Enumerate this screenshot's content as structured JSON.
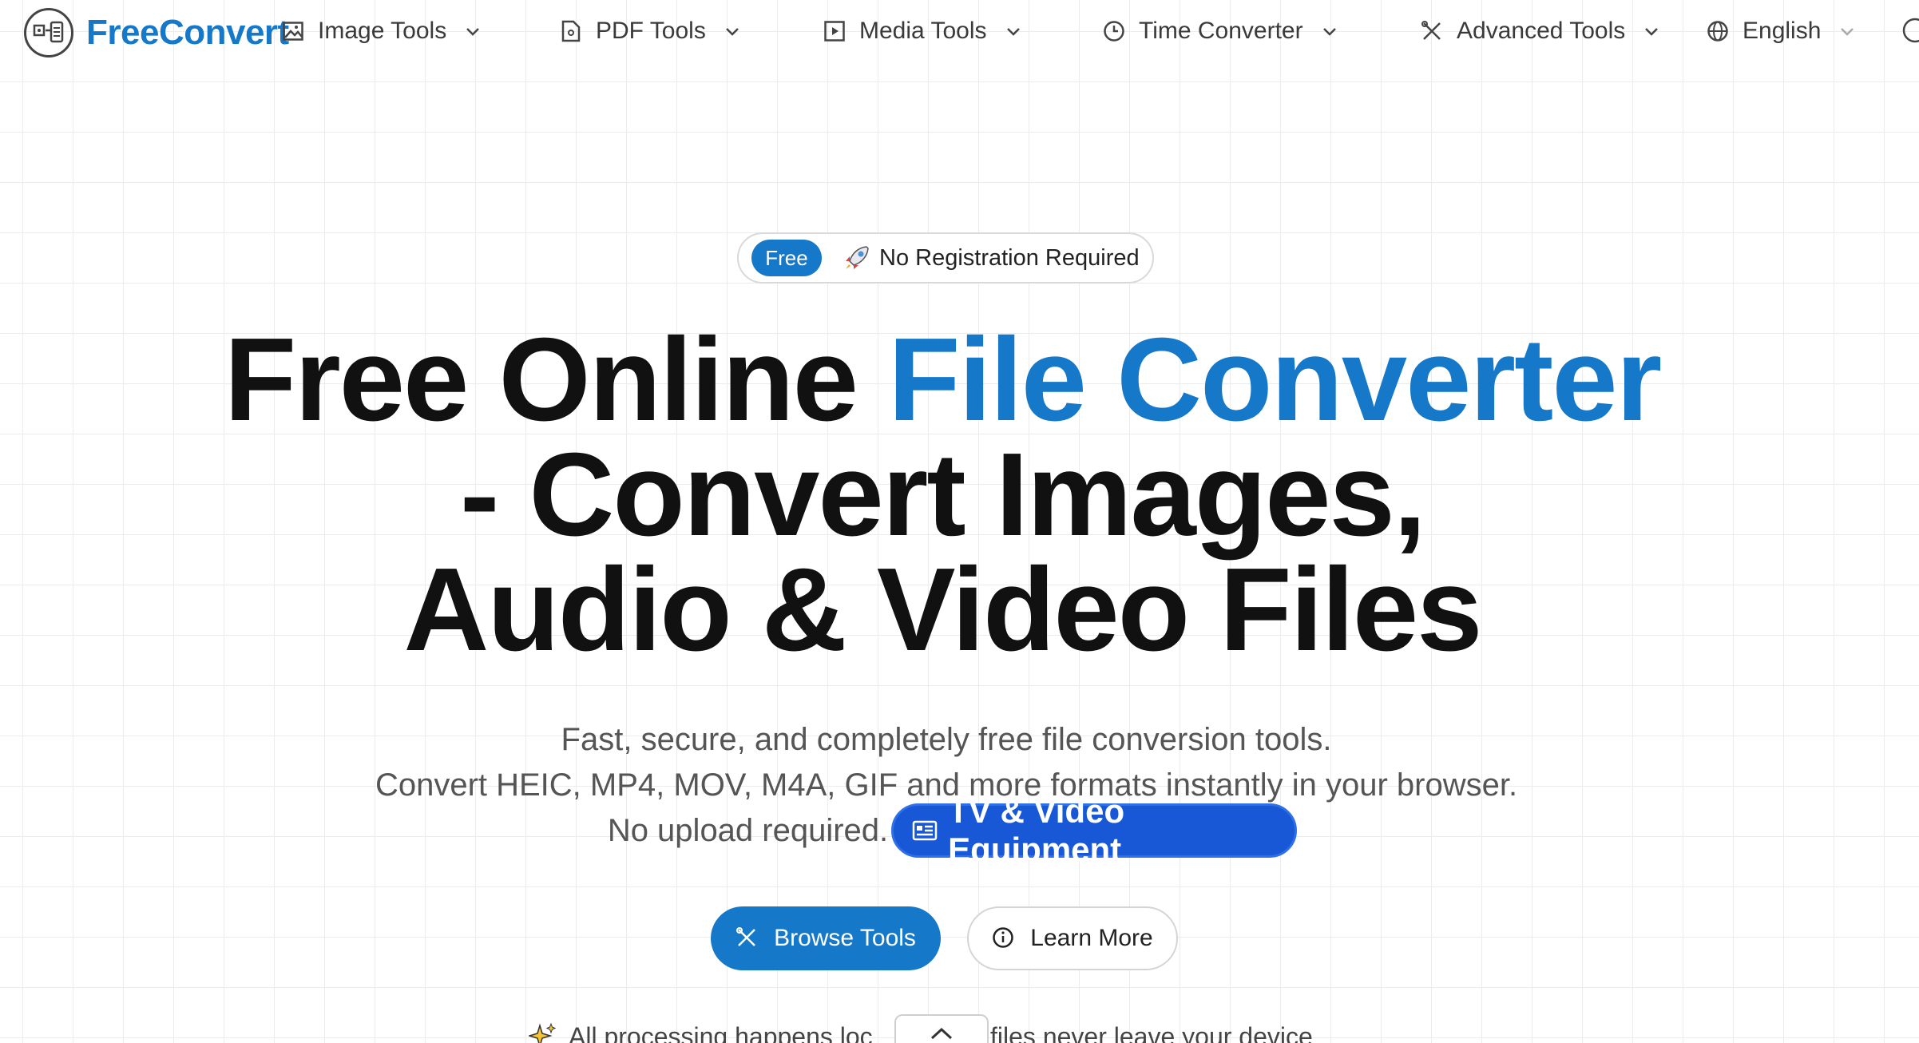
{
  "brand": {
    "name": "FreeConvert"
  },
  "nav": {
    "items": [
      {
        "label": "Image Tools",
        "icon": "image-icon"
      },
      {
        "label": "PDF Tools",
        "icon": "document-icon"
      },
      {
        "label": "Media Tools",
        "icon": "play-icon"
      },
      {
        "label": "Time Converter",
        "icon": "clock-icon"
      },
      {
        "label": "Advanced Tools",
        "icon": "tools-icon"
      },
      {
        "label": "English",
        "icon": "globe-icon"
      }
    ]
  },
  "badge": {
    "pill": "Free",
    "text": "No Registration Required",
    "icon": "rocket-icon"
  },
  "headline": {
    "part1": "Free Online ",
    "accent": "File Converter",
    "line2": "- Convert Images,",
    "line3": "Audio & Video Files"
  },
  "subtext": {
    "line1": "Fast, secure, and completely free file conversion tools.",
    "line2": "Convert HEIC, MP4, MOV, M4A, GIF and more formats instantly in your browser.",
    "line3": "No upload required."
  },
  "popup": {
    "label": "TV & Video Equipment",
    "icon": "tv-list-icon"
  },
  "buttons": {
    "primary": {
      "label": "Browse Tools",
      "icon": "tools-icon"
    },
    "secondary": {
      "label": "Learn More",
      "icon": "info-icon"
    }
  },
  "footnote": {
    "left": "All processing happens loc",
    "right": "ur files never leave your device"
  },
  "colors": {
    "accent": "#1578c8",
    "popup": "#1857d6"
  }
}
